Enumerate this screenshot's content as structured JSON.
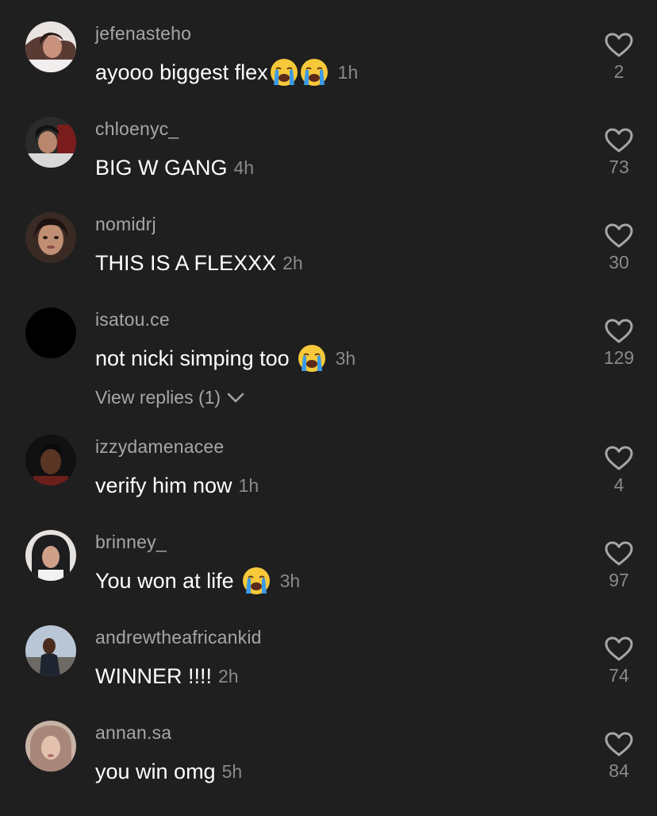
{
  "colors": {
    "background": "#1f1f1f",
    "username": "#a6a6a6",
    "body_text": "#ffffff",
    "meta_text": "#8a8a8a"
  },
  "icons": {
    "like": "heart-outline-icon",
    "emoji": "loudly-crying-face-emoji",
    "replies": "chevron-down-icon"
  },
  "comments": [
    {
      "username": "jefenasteho",
      "text": "ayooo biggest flex",
      "emojis": 2,
      "time": "1h",
      "likes": "2"
    },
    {
      "username": "chloenyc_",
      "text": "BIG W GANG",
      "emojis": 0,
      "time": "4h",
      "likes": "73"
    },
    {
      "username": "nomidrj",
      "text": "THIS IS A FLEXXX",
      "emojis": 0,
      "time": "2h",
      "likes": "30"
    },
    {
      "username": "isatou.ce",
      "text": "not nicki simping too",
      "emojis": 1,
      "time": "3h",
      "likes": "129",
      "view_replies": "View replies (1)"
    },
    {
      "username": "izzydamenacee",
      "text": "verify him now",
      "emojis": 0,
      "time": "1h",
      "likes": "4"
    },
    {
      "username": "brinney_",
      "text": "You won at life",
      "emojis": 1,
      "time": "3h",
      "likes": "97"
    },
    {
      "username": "andrewtheafricankid",
      "text": "WINNER !!!!",
      "emojis": 0,
      "time": "2h",
      "likes": "74"
    },
    {
      "username": "annan.sa",
      "text": "you win omg",
      "emojis": 0,
      "time": "5h",
      "likes": "84"
    }
  ]
}
